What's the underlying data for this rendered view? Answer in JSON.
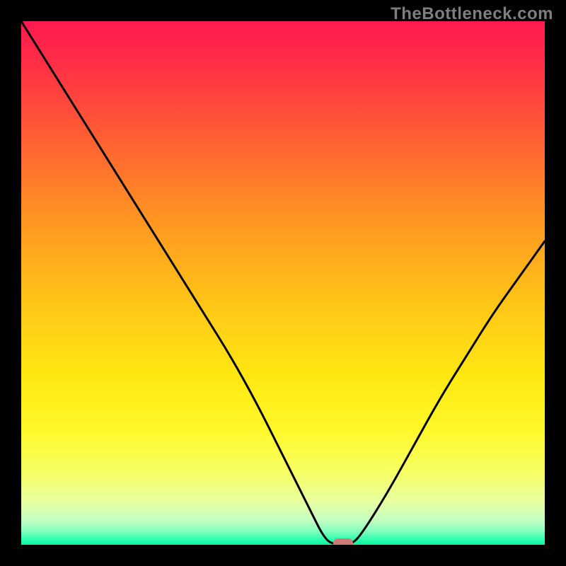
{
  "watermark": "TheBottleneck.com",
  "chart_data": {
    "type": "line",
    "title": "",
    "xlabel": "",
    "ylabel": "",
    "xlim": [
      0,
      100
    ],
    "ylim": [
      0,
      100
    ],
    "grid": false,
    "legend": false,
    "series": [
      {
        "name": "curve",
        "x": [
          0,
          5,
          10,
          15,
          20,
          25,
          30,
          35,
          40,
          45,
          50,
          55,
          58,
          60,
          63,
          65,
          70,
          75,
          80,
          85,
          90,
          95,
          100
        ],
        "y": [
          100,
          92,
          84,
          76,
          68,
          60,
          52,
          44,
          36,
          27,
          17,
          7,
          1,
          0,
          0,
          2,
          10,
          19,
          28,
          36,
          44,
          51,
          58
        ]
      }
    ],
    "marker": {
      "x": 61.5,
      "y": 0,
      "color": "#cf7a78"
    },
    "background_gradient": {
      "stops": [
        {
          "pos": 0.0,
          "color": "#ff1a4f"
        },
        {
          "pos": 0.07,
          "color": "#ff2b48"
        },
        {
          "pos": 0.18,
          "color": "#ff5038"
        },
        {
          "pos": 0.3,
          "color": "#ff7a2a"
        },
        {
          "pos": 0.42,
          "color": "#ffa21f"
        },
        {
          "pos": 0.55,
          "color": "#ffc816"
        },
        {
          "pos": 0.68,
          "color": "#ffe812"
        },
        {
          "pos": 0.78,
          "color": "#fff82a"
        },
        {
          "pos": 0.86,
          "color": "#f7ff62"
        },
        {
          "pos": 0.92,
          "color": "#e6ffa2"
        },
        {
          "pos": 0.955,
          "color": "#c0ffc3"
        },
        {
          "pos": 0.975,
          "color": "#7dffbd"
        },
        {
          "pos": 0.99,
          "color": "#2dffb0"
        },
        {
          "pos": 1.0,
          "color": "#0cf59d"
        }
      ]
    }
  }
}
